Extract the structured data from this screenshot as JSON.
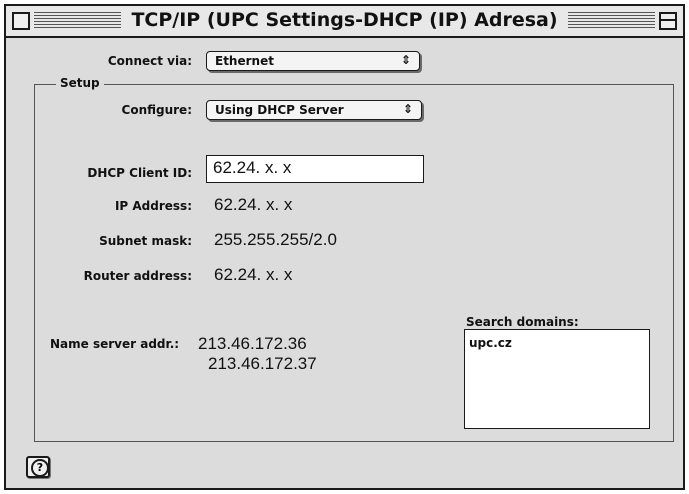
{
  "window": {
    "title": "TCP/IP (UPC Settings-DHCP (IP) Adresa)"
  },
  "connect_via": {
    "label": "Connect via:",
    "value": "Ethernet",
    "arrows": "⇕"
  },
  "setup": {
    "legend": "Setup",
    "configure_label": "Configure:",
    "configure_value": "Using DHCP Server",
    "configure_arrows": "⇕",
    "dhcp_client_id_label": "DHCP Client ID:",
    "dhcp_client_id_value": "62.24. x. x",
    "ip_address_label": "IP Address:",
    "ip_address_value": "62.24. x. x",
    "subnet_mask_label": "Subnet mask:",
    "subnet_mask_value": "255.255.255/2.0",
    "router_address_label": "Router address:",
    "router_address_value": "62.24. x. x",
    "name_server_label": "Name server addr.:",
    "name_servers": [
      "213.46.172.36",
      "213.46.172.37"
    ],
    "search_domains_label": "Search domains:",
    "search_domains_value": "upc.cz"
  },
  "help": {
    "glyph": "?"
  }
}
